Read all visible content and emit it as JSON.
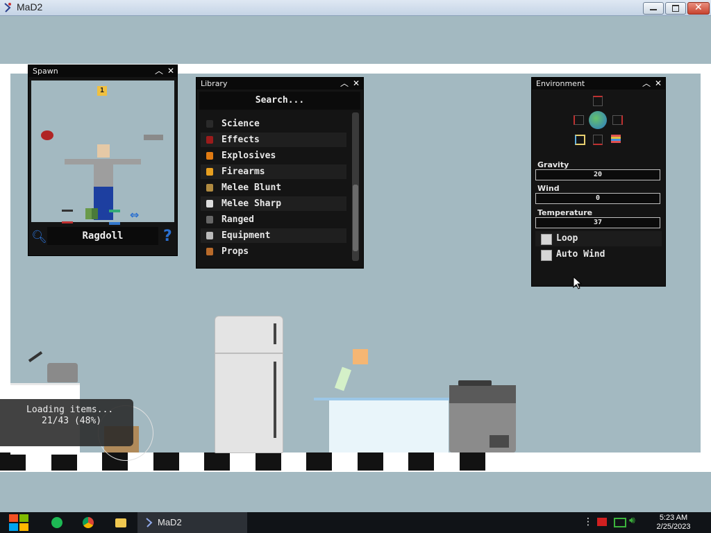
{
  "window": {
    "title": "MaD2"
  },
  "spawn": {
    "title": "Spawn",
    "count_badge": "1",
    "item_name": "Ragdoll",
    "help_glyph": "?"
  },
  "library": {
    "title": "Library",
    "search_placeholder": "Search...",
    "categories": [
      {
        "label": "Science",
        "icon": "science-icon",
        "color": "#2a2a2a"
      },
      {
        "label": "Effects",
        "icon": "effects-icon",
        "color": "#9b1b1b"
      },
      {
        "label": "Explosives",
        "icon": "explosives-icon",
        "color": "#e07a12"
      },
      {
        "label": "Firearms",
        "icon": "firearms-icon",
        "color": "#e8a020"
      },
      {
        "label": "Melee Blunt",
        "icon": "melee-blunt-icon",
        "color": "#b08a40"
      },
      {
        "label": "Melee Sharp",
        "icon": "melee-sharp-icon",
        "color": "#dddddd"
      },
      {
        "label": "Ranged",
        "icon": "ranged-icon",
        "color": "#666666"
      },
      {
        "label": "Equipment",
        "icon": "equipment-icon",
        "color": "#bbbbbb"
      },
      {
        "label": "Props",
        "icon": "props-icon",
        "color": "#b86a2a"
      }
    ]
  },
  "environment": {
    "title": "Environment",
    "gravity_label": "Gravity",
    "gravity_value": "20",
    "wind_label": "Wind",
    "wind_value": "0",
    "temperature_label": "Temperature",
    "temperature_value": "37",
    "loop_label": "Loop",
    "auto_wind_label": "Auto Wind"
  },
  "loading": {
    "line1": "Loading items...",
    "line2": "21/43 (48%)",
    "progress": 0.48
  },
  "taskbar": {
    "app_label": "MaD2",
    "time": "5:23 AM",
    "date": "2/25/2023"
  },
  "colors": {
    "sky": "#a3b9c1",
    "panel": "#141414",
    "accent_blue": "#2a6fd0"
  }
}
